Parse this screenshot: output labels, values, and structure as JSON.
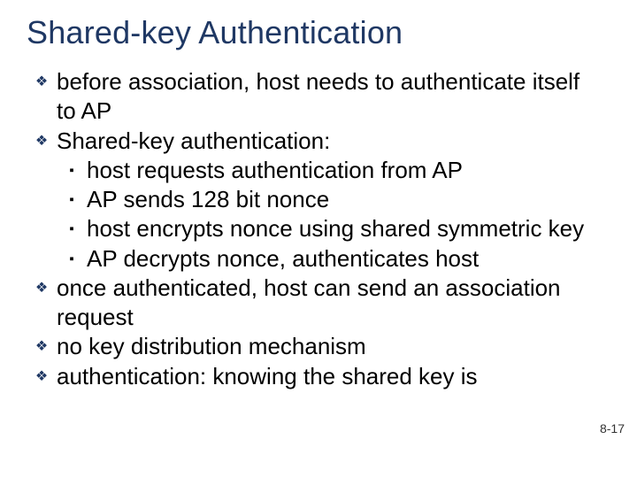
{
  "title": "Shared-key Authentication",
  "bullets": [
    {
      "text": "before association, host needs to authenticate itself to AP"
    },
    {
      "text": "Shared-key authentication:",
      "sub": [
        "host requests authentication from AP",
        "AP sends 128 bit nonce",
        "host encrypts nonce using shared symmetric key",
        "AP decrypts nonce, authenticates host"
      ]
    },
    {
      "text": "once authenticated, host can send an association request"
    },
    {
      "text": "no key distribution mechanism"
    },
    {
      "text": "authentication: knowing the shared key is"
    }
  ],
  "page_number": "8-17"
}
